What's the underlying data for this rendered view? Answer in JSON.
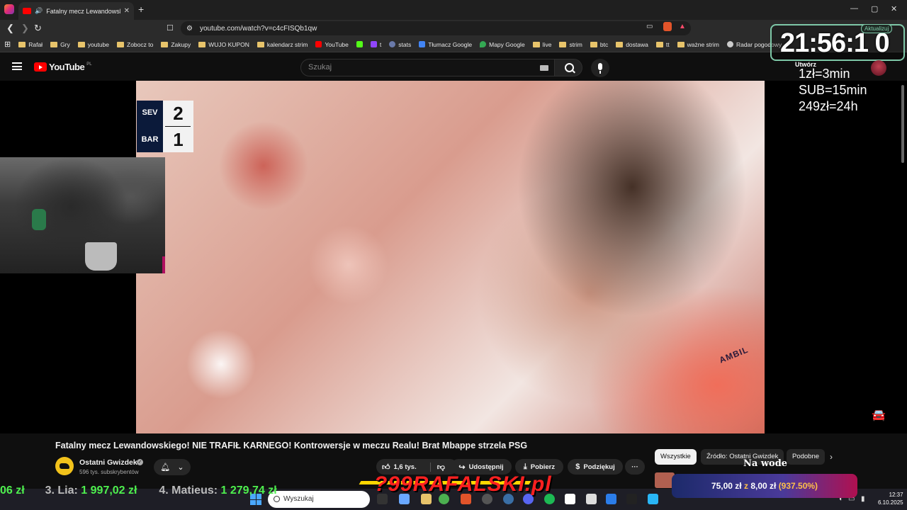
{
  "browser": {
    "tab_title": "Fatalny mecz Lewandowskiego! NIE TRAFIŁ KARNEGO!",
    "tab_audio_icon": "speaker-icon",
    "new_tab": "+",
    "url": "youtube.com/watch?v=c4cFISQb1qw",
    "window_controls": [
      "—",
      "▢",
      "✕"
    ]
  },
  "bookmarks": [
    {
      "label": "Rafał",
      "icon": "folder"
    },
    {
      "label": "Gry",
      "icon": "folder"
    },
    {
      "label": "youtube",
      "icon": "folder"
    },
    {
      "label": "Zobocz to",
      "icon": "folder"
    },
    {
      "label": "Zakupy",
      "icon": "folder"
    },
    {
      "label": "WUJO KUPON",
      "icon": "folder"
    },
    {
      "label": "kalendarz strim",
      "icon": "folder"
    },
    {
      "label": "YouTube",
      "icon": "youtube"
    },
    {
      "label": "",
      "icon": "kick"
    },
    {
      "label": "t",
      "icon": "twitch"
    },
    {
      "label": "stats",
      "icon": "stats"
    },
    {
      "label": "Tłumacz Google",
      "icon": "translate"
    },
    {
      "label": "Mapy Google",
      "icon": "maps"
    },
    {
      "label": "live",
      "icon": "folder"
    },
    {
      "label": "strim",
      "icon": "folder"
    },
    {
      "label": "btc",
      "icon": "folder"
    },
    {
      "label": "dostawa",
      "icon": "folder"
    },
    {
      "label": "tt",
      "icon": "folder"
    },
    {
      "label": "ważne strim",
      "icon": "folder"
    },
    {
      "label": "Radar pogodowy",
      "icon": "radar"
    }
  ],
  "youtube": {
    "logo_text": "YouTube",
    "logo_region": "PL",
    "search_placeholder": "Szukaj",
    "create_label": "Utwórz"
  },
  "video": {
    "title": "Fatalny mecz Lewandowskiego! NIE TRAFIŁ KARNEGO! Kontrowersje w meczu Realu! Brat Mbappe strzela PSG",
    "shirt_text": "AMBIL",
    "score": {
      "home": "SEV",
      "home_goals": "2",
      "away": "BAR",
      "away_goals": "1"
    }
  },
  "channel": {
    "name": "Ostatni Gwizdek",
    "subscribers": "596 tys. subskrybentów"
  },
  "actions": {
    "likes": "1,6 tys.",
    "share": "Udostępnij",
    "download": "Pobierz",
    "thanks": "Podziękuj",
    "more": "···"
  },
  "chips": [
    "Wszystkie",
    "Źródło: Ostatni Gwizdek",
    "Podobne"
  ],
  "related": {
    "title_overlay": "Na wode"
  },
  "overlay": {
    "clock": "21:56:1 0",
    "update_label": "Aktualizuj",
    "rates": [
      "1zł=3min",
      "SUB=15min",
      "249zł=24h"
    ],
    "donation": {
      "amount": "75,00 zł",
      "z": "z",
      "goal": "8,00 zł",
      "percent": "(937.50%)"
    },
    "ticker": [
      {
        "rank": "",
        "name": "",
        "value": "06 zł"
      },
      {
        "rank": "3.",
        "name": "Lia:",
        "value": "1 997,02 zł"
      },
      {
        "rank": "4.",
        "name": "Matieus:",
        "value": "1 279,74 zł"
      }
    ],
    "streamer_logo": "?99RAFALSKI.pl"
  },
  "taskbar": {
    "search_placeholder": "Wyszukaj",
    "time": "12:37",
    "date": "6.10.2025"
  },
  "colors": {
    "youtube_red": "#ff0000",
    "clock_border": "#7ec8a8",
    "ticker_value": "#4ef04e",
    "donation_accent": "#ffc04a"
  }
}
